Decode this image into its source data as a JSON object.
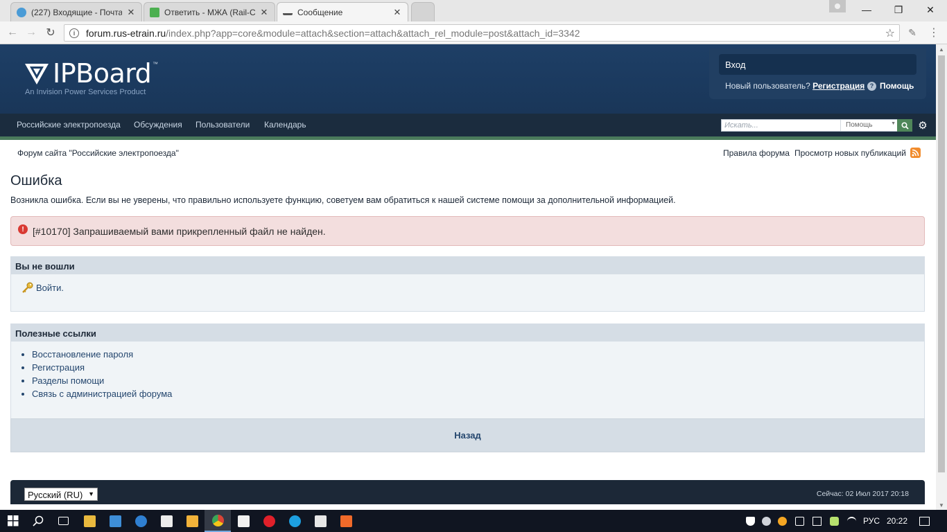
{
  "browser": {
    "tabs": [
      {
        "title": "(227) Входящие - Почта",
        "icon": "mail-icon",
        "color": "#4a9bd6"
      },
      {
        "title": "Ответить - МЖА (Rail-Cl",
        "icon": "rail-icon",
        "color": "#4caf50"
      },
      {
        "title": "Сообщение",
        "icon": "train-icon",
        "color": "#555555"
      }
    ],
    "url_host": "forum.rus-etrain.ru",
    "url_path": "/index.php?app=core&module=attach&section=attach&attach_rel_module=post&attach_id=3342"
  },
  "header": {
    "logo_word": "IPBoard",
    "logo_tm": "™",
    "logo_sub": "An Invision Power Services Product",
    "signin_label": "Вход",
    "newuser_label": "Новый пользователь?",
    "register_label": "Регистрация",
    "help_label": "Помощь"
  },
  "nav": {
    "items": [
      "Российские электропоезда",
      "Обсуждения",
      "Пользователи",
      "Календарь"
    ],
    "search_placeholder": "Искать...",
    "search_scope": "Помощь"
  },
  "secondary": {
    "breadcrumb": "Форум сайта \"Российские электропоезда\"",
    "rules": "Правила форума",
    "new_posts": "Просмотр новых публикаций"
  },
  "page": {
    "title": "Ошибка",
    "description": "Возникла ошибка. Если вы не уверены, что правильно используете функцию, советуем вам обратиться к нашей системе помощи за дополнительной информацией.",
    "error_message": "[#10170] Запрашиваемый вами прикрепленный файл не найден."
  },
  "login_block": {
    "heading": "Вы не вошли",
    "login_link": "Войти."
  },
  "links_block": {
    "heading": "Полезные ссылки",
    "links": [
      "Восстановление пароля",
      "Регистрация",
      "Разделы помощи",
      "Связь с администрацией форума"
    ]
  },
  "back_label": "Назад",
  "footer": {
    "language": "Русский (RU)",
    "time": "Сейчас: 02 Июл 2017 20:18"
  },
  "taskbar": {
    "lang": "РУС",
    "clock": "20:22"
  },
  "colors": {
    "brand_dark": "#1b3a5f",
    "nav_bar": "#1b2c3e",
    "accent_green": "#4a7a5b",
    "error_bg": "#f3dede",
    "link": "#24466e"
  }
}
